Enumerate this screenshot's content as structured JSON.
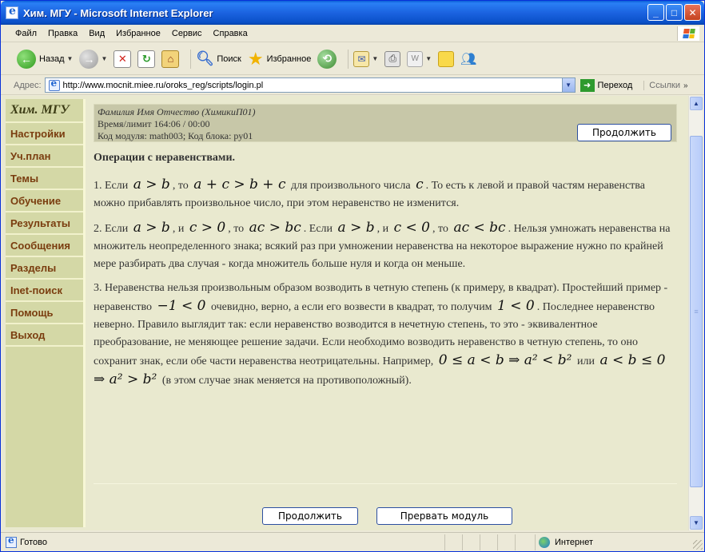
{
  "window": {
    "title": "Хим. МГУ - Microsoft Internet Explorer"
  },
  "menu": {
    "items": [
      {
        "label": "Файл"
      },
      {
        "label": "Правка"
      },
      {
        "label": "Вид"
      },
      {
        "label": "Избранное"
      },
      {
        "label": "Сервис"
      },
      {
        "label": "Справка"
      }
    ]
  },
  "toolbar": {
    "back": "Назад",
    "search": "Поиск",
    "favorites": "Избранное"
  },
  "address": {
    "label": "Адрес:",
    "url": "http://www.mocnit.miee.ru/oroks_reg/scripts/login.pl",
    "go": "Переход",
    "links": "Ссылки"
  },
  "sidebar": {
    "title": "Хим. МГУ",
    "items": [
      {
        "label": "Настройки"
      },
      {
        "label": "Уч.план"
      },
      {
        "label": "Темы"
      },
      {
        "label": "Обучение"
      },
      {
        "label": "Результаты"
      },
      {
        "label": "Сообщения"
      },
      {
        "label": "Разделы"
      },
      {
        "label": "Inet-поиск"
      },
      {
        "label": "Помощь"
      },
      {
        "label": "Выход"
      }
    ]
  },
  "info": {
    "name": "Фамилия Имя Отчество (ХимикиП01)",
    "time": "Время/лимит 164:06 / 00:00",
    "module": "Код модуля: math003; Код блока: ру01",
    "continue": "Продолжить"
  },
  "lesson": {
    "heading": "Операции с неравенствами.",
    "p1": {
      "a": "1. Если",
      "m1": "a > b",
      "b": ", то",
      "m2": "a + c > b + c",
      "c": "для произвольного числа",
      "m3": "c",
      "d": ". То есть к левой и правой частям неравенства можно прибавлять произвольное число, при этом неравенство не изменится."
    },
    "p2": {
      "a": "2. Если",
      "m1": "a > b",
      "b": ", и",
      "m2": "c > 0",
      "c": ", то",
      "m3": "ac > bc",
      "d": ". Если",
      "m4": "a > b",
      "e": ", и",
      "m5": "c < 0",
      "f": ", то",
      "m6": "ac < bc",
      "g": ". Нельзя умножать неравенства на множитель неопределенного знака; всякий раз при умножении неравенства на некоторое выражение нужно по крайней мере разбирать два случая - когда множитель больше нуля и когда он меньше."
    },
    "p3": {
      "a": "3. Неравенства нельзя произвольным образом возводить в четную степень (к примеру, в квадрат). Простейший пример - неравенство",
      "m1": "−1 < 0",
      "b": "очевидно, верно, а если его возвести в квадрат, то получим",
      "m2": "1 < 0",
      "c": ". Последнее неравенство неверно. Правило выглядит так: если неравенство возводится в нечетную степень, то это - эквивалентное преобразование, не меняющее решение задачи. Если необходимо возводить неравенство в четную степень, то оно сохранит знак, если обе части неравенства неотрицательны. Например,",
      "m3": "0 ≤ a < b ⇒ a² < b²",
      "d": "или",
      "m4": "a < b ≤ 0 ⇒ a² > b²",
      "e": "(в этом случае знак меняется на противоположный)."
    }
  },
  "buttons": {
    "continue": "Продолжить",
    "abort": "Прервать модуль"
  },
  "status": {
    "text": "Готово",
    "zone": "Интернет"
  },
  "colors": {
    "titlebar": "#0a50c8",
    "sidebar_bg": "#d4d8a6",
    "sidebar_link": "#7a3d0f",
    "content_bg": "#e9e9cf",
    "info_bg": "#c7c7a8"
  }
}
